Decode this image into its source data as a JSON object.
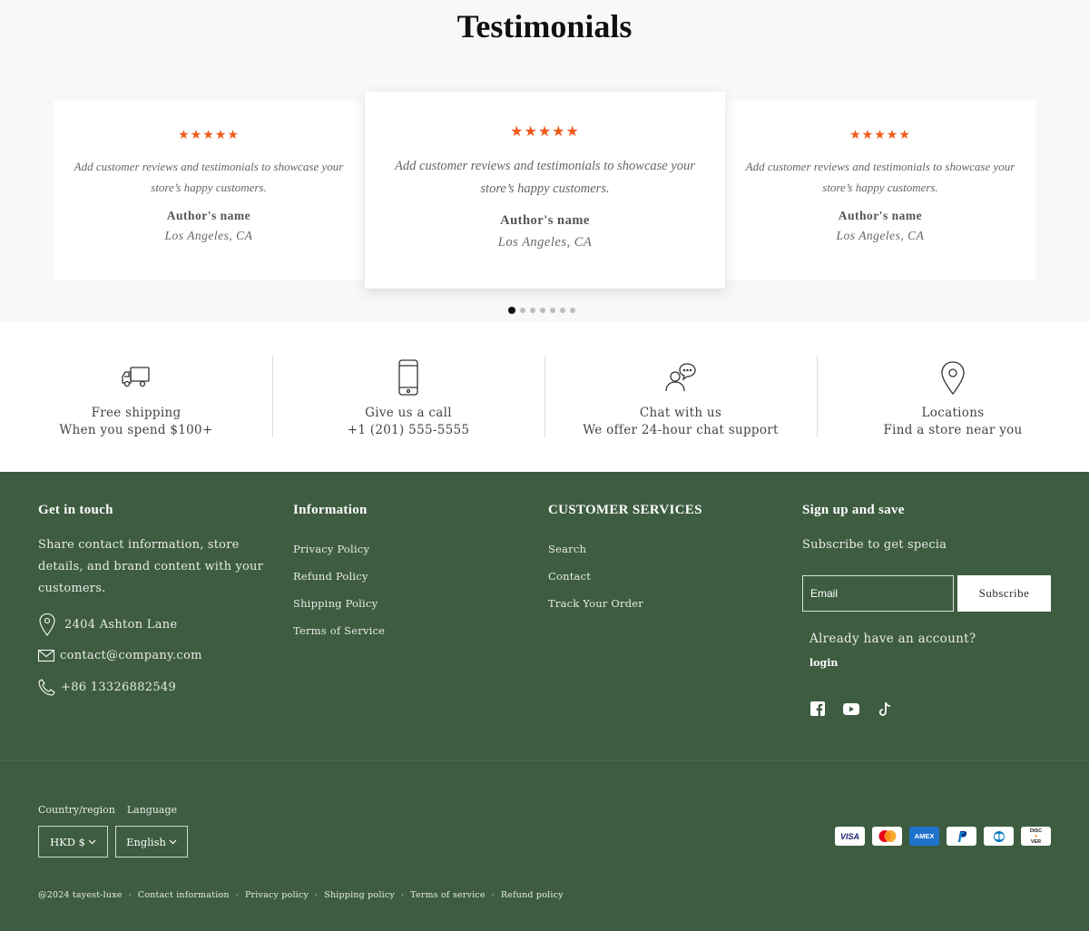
{
  "testimonials": {
    "title": "Testimonials",
    "stars": "★★★★★",
    "rating": 5,
    "cards": [
      {
        "quote": "Add customer reviews and testimonials to showcase your store’s happy customers.",
        "author": "Author's name",
        "location": "Los Angeles, CA"
      },
      {
        "quote": "Add customer reviews and testimonials to showcase your store’s happy customers.",
        "author": "Author's name",
        "location": "Los Angeles, CA"
      },
      {
        "quote": "Add customer reviews and testimonials to showcase your store’s happy customers.",
        "author": "Author's name",
        "location": "Los Angeles, CA"
      }
    ],
    "pagination_count": 7,
    "active_page": 1
  },
  "features": [
    {
      "icon": "truck-icon",
      "title": "Free shipping",
      "subtitle": "When you spend $100+"
    },
    {
      "icon": "phone-icon",
      "title": "Give us a call",
      "subtitle": "+1 (201) 555-5555"
    },
    {
      "icon": "chat-person-icon",
      "title": "Chat with us",
      "subtitle": "We offer 24-hour chat support"
    },
    {
      "icon": "location-pin-icon",
      "title": "Locations",
      "subtitle": "Find a store near you"
    }
  ],
  "footer": {
    "colors": {
      "background": "#3d5c40",
      "star": "#f05a1a"
    },
    "contact": {
      "heading": "Get in touch",
      "text": "Share contact information, store details, and brand content with your customers.",
      "address": "2404 Ashton Lane",
      "email": "contact@company.com",
      "phone": "+86 13326882549"
    },
    "information": {
      "heading": "Information",
      "links": [
        "Privacy Policy",
        "Refund Policy",
        "Shipping Policy",
        "Terms of Service"
      ]
    },
    "customer_services": {
      "heading": "CUSTOMER SERVICES",
      "links": [
        "Search",
        "Contact",
        "Track Your Order"
      ]
    },
    "newsletter": {
      "heading": "Sign up and save",
      "text": "Subscribe to get specia",
      "email_placeholder": "Email",
      "subscribe_label": "Subscribe",
      "account_text": "Already have an account?",
      "login_label": "login"
    },
    "socials": [
      "facebook-icon",
      "youtube-icon",
      "tiktok-icon"
    ],
    "localization": {
      "country_label": "Country/region",
      "language_label": "Language",
      "currency": "HKD $",
      "language": "English"
    },
    "payments": [
      "VISA",
      "Mastercard",
      "AMEX",
      "PayPal",
      "Diners Club",
      "DISCOVER"
    ],
    "bottom": {
      "copyright": "@2024 tayest-luxe",
      "links": [
        "Contact information",
        "Privacy policy",
        "Shipping policy",
        "Terms of service",
        "Refund policy"
      ],
      "separator": "·"
    }
  }
}
